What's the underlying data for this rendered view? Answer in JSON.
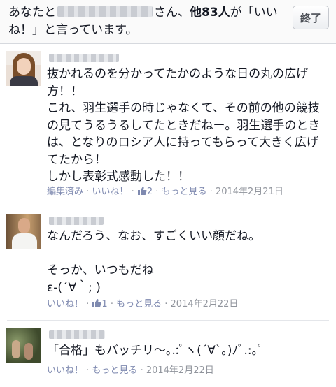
{
  "header": {
    "prefix": "あなたと",
    "middle": "さん、",
    "count_text": "他83人",
    "suffix": "が「いいね！」と言っています。",
    "end_button": "終了"
  },
  "comments": [
    {
      "text": "抜かれるのを分かってたかのような日の丸の広げ方！！\nこれ、羽生選手の時じゃなくて、その前の他の競技の見てうるうるしてたときだねー。羽生選手のときは、となりのロシア人に持ってもらって大きく広げてたから！\nしかし表彰式感動した！！",
      "edited": "編集済み",
      "like": "いいね！",
      "likes": "2",
      "more": "もっと見る",
      "date": "2014年2月21日"
    },
    {
      "text": "なんだろう、なお、すごくいい顔だね。\n\nそっか、いつもだね\nε-(´∀｀; )",
      "like": "いいね！",
      "likes": "1",
      "more": "もっと見る",
      "date": "2014年2月22日"
    },
    {
      "text": "「合格」もバッチリ〜｡.:ﾟヽ(´∀`｡)ﾉﾟ.:｡ﾟ",
      "like": "いいね！",
      "more": "もっと見る",
      "date": "2014年2月22日"
    }
  ],
  "colors": {
    "link": "#7f8ab0",
    "meta": "#90949c",
    "text": "#141823"
  },
  "icons": {
    "like": "thumbs-up-icon"
  }
}
